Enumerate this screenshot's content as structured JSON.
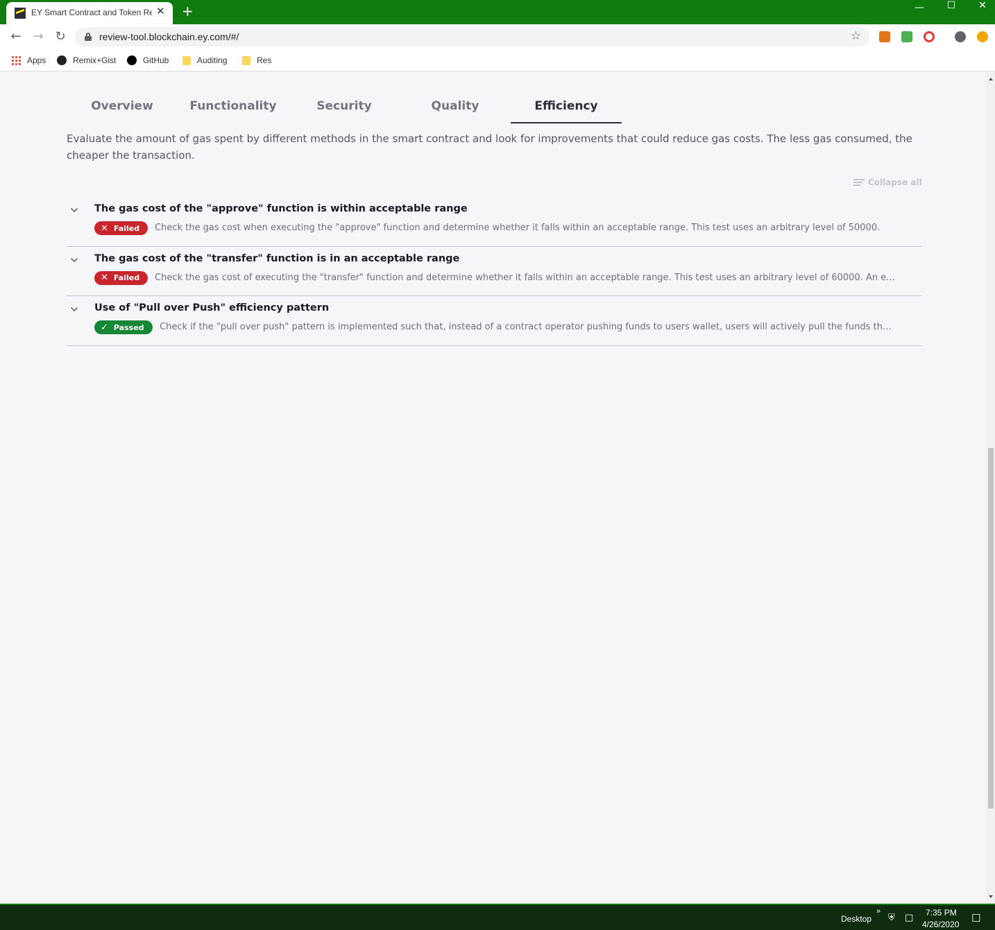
{
  "browser": {
    "tab_title": "EY Smart Contract and Token Review",
    "tab_close": "✕",
    "new_tab": "+",
    "url": "review-tool.blockchain.ey.com/#/",
    "window_controls": {
      "minimize": "—",
      "maximize": "☐",
      "close": "✕"
    },
    "bookmarks": [
      "Apps",
      "Remix+Gist",
      "GitHub",
      "Auditing",
      "Res"
    ]
  },
  "page": {
    "tabs": [
      "Overview",
      "Functionality",
      "Security",
      "Quality",
      "Efficiency"
    ],
    "active_tab": "Efficiency",
    "description": "Evaluate the amount of gas spent by different methods in the smart contract and look for improvements that could reduce gas costs. The less gas consumed, the cheaper the transaction.",
    "collapse_all": "Collapse all",
    "items": [
      {
        "title": "The gas cost of the \"approve\" function is within acceptable range",
        "status": "Failed",
        "status_icon": "✕",
        "description": "Check the gas cost when executing the \"approve\" function and determine whether it falls within an acceptable range. This test uses an arbitrary level of 50000."
      },
      {
        "title": "The gas cost of the \"transfer\" function is in an acceptable range",
        "status": "Failed",
        "status_icon": "✕",
        "description": "Check the gas cost of executing the \"transfer\" function and determine whether it falls within an acceptable range. This test uses an arbitrary level of 60000. An ex..."
      },
      {
        "title": "Use of \"Pull over Push\" efficiency pattern",
        "status": "Passed",
        "status_icon": "✓",
        "description": "Check if the \"pull over push\" pattern is implemented such that, instead of a contract operator pushing funds to users wallet, users will actively pull the funds the..."
      }
    ]
  },
  "taskbar": {
    "desktop_label": "Desktop",
    "chevron": "»",
    "time": "7:35 PM",
    "date": "4/26/2020"
  },
  "colors": {
    "chrome_green": "#107c10",
    "failed": "#c9252c",
    "passed": "#168736",
    "ey_yellow": "#ffe600"
  }
}
